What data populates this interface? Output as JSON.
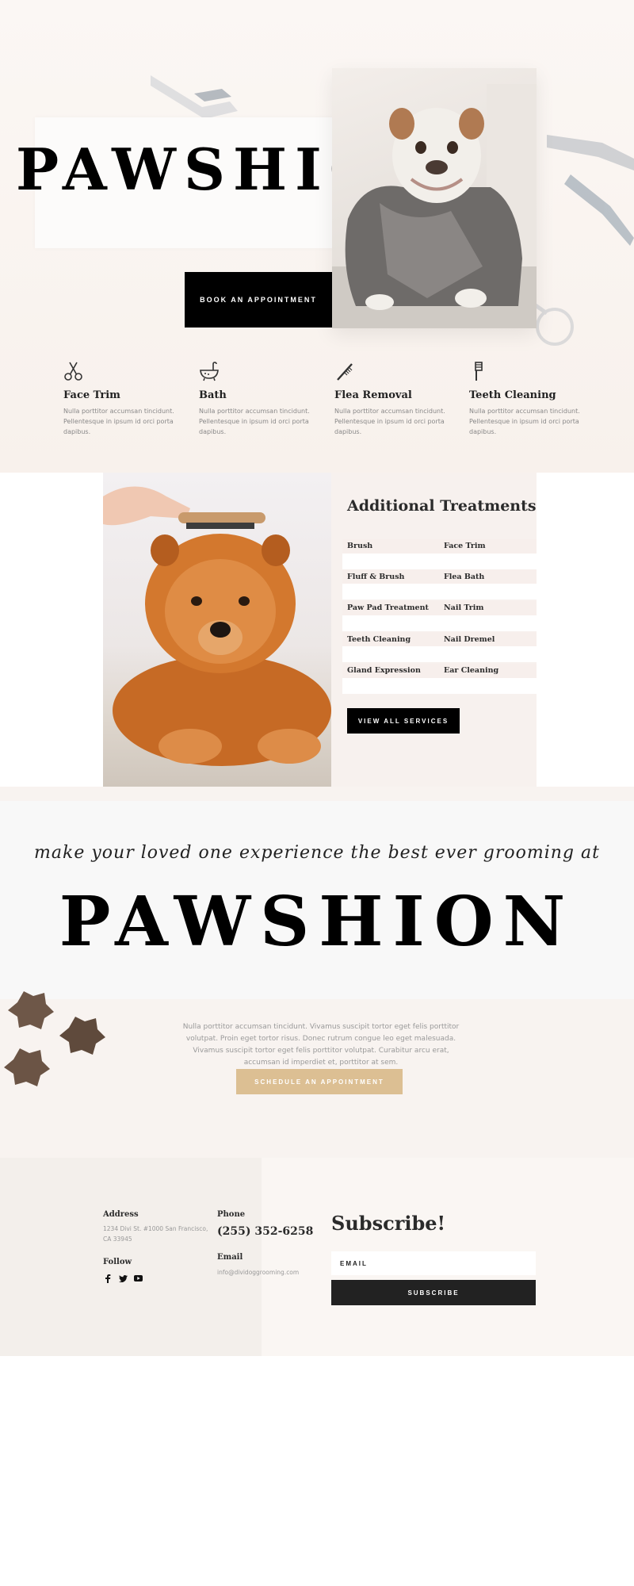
{
  "hero": {
    "title": "PAWSHION",
    "cta_label": "BOOK AN APPOINTMENT",
    "photo_subject": "bulldog-in-towel"
  },
  "services": [
    {
      "icon": "scissors-icon",
      "title": "Face Trim",
      "text": "Nulla porttitor accumsan tincidunt. Pellentesque in ipsum id orci porta dapibus."
    },
    {
      "icon": "bathtub-icon",
      "title": "Bath",
      "text": "Nulla porttitor accumsan tincidunt. Pellentesque in ipsum id orci porta dapibus."
    },
    {
      "icon": "comb-icon",
      "title": "Flea Removal",
      "text": "Nulla porttitor accumsan tincidunt. Pellentesque in ipsum id orci porta dapibus."
    },
    {
      "icon": "toothbrush-icon",
      "title": "Teeth Cleaning",
      "text": "Nulla porttitor accumsan tincidunt. Pellentesque in ipsum id orci porta dapibus."
    }
  ],
  "treatments": {
    "title": "Additional Treatments",
    "rows": [
      [
        "Brush",
        "Face Trim"
      ],
      [
        "Fluff & Brush",
        "Flea Bath"
      ],
      [
        "Paw Pad Treatment",
        "Nail Trim"
      ],
      [
        "Teeth Cleaning",
        "Nail Dremel"
      ],
      [
        "Gland Expression",
        "Ear Cleaning"
      ]
    ],
    "cta_label": "VIEW ALL SERVICES",
    "photo_subject": "chow-chow-being-brushed"
  },
  "promo": {
    "tagline": "make your loved one experience the best ever grooming at",
    "title": "PAWSHION",
    "text": "Nulla porttitor accumsan tincidunt. Vivamus suscipit tortor eget felis porttitor volutpat. Proin eget tortor risus. Donec rutrum congue leo eget malesuada. Vivamus suscipit tortor eget felis porttitor volutpat. Curabitur arcu erat, accumsan id imperdiet et, porttitor at sem.",
    "cta_label": "SCHEDULE AN APPOINTMENT"
  },
  "footer": {
    "address_label": "Address",
    "address_line1": "1234 Divi St. #1000 San Francisco,",
    "address_line2": "CA 33945",
    "follow_label": "Follow",
    "social": [
      "facebook-icon",
      "twitter-icon",
      "youtube-icon"
    ],
    "phone_label": "Phone",
    "phone": "(255) 352-6258",
    "email_label": "Email",
    "email": "info@dividoggrooming.com",
    "subscribe_title": "Subscribe!",
    "email_placeholder": "EMAIL",
    "subscribe_label": "SUBSCRIBE"
  },
  "colors": {
    "accent": "#dcbf93",
    "dark": "#000000",
    "cream": "#f8f3f0",
    "panel": "#f7f1ee"
  }
}
